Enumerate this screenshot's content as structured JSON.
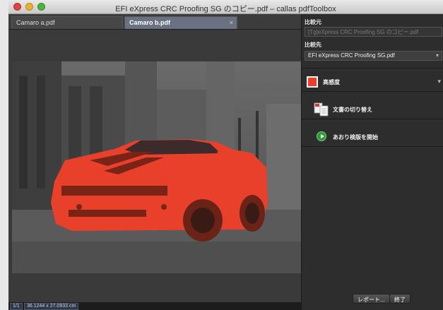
{
  "window": {
    "title": "EFI eXpress CRC Proofing SG のコピー.pdf – callas pdfToolbox"
  },
  "tabs": [
    {
      "label": "Camaro a.pdf"
    },
    {
      "label": "Camaro b.pdf",
      "close_glyph": "×"
    }
  ],
  "status_bar": {
    "page": "1/1",
    "size": "36.1244 x 27.0933 cm"
  },
  "sidebar": {
    "compare_source_label": "比較元",
    "compare_source_value": "[Tg]eXpress CRC Proofing SG のコピー.pdf",
    "compare_target_label": "比較先",
    "compare_target_value": "EFI eXpress CRC Proofing SG.pdf",
    "highlight_label": "高感度",
    "highlight_color": "#e8402a",
    "switch_docs_label": "文書の切り替え",
    "start_proof_label": "あおり検版を開始",
    "report_button": "レポート...",
    "end_button": "終了"
  }
}
